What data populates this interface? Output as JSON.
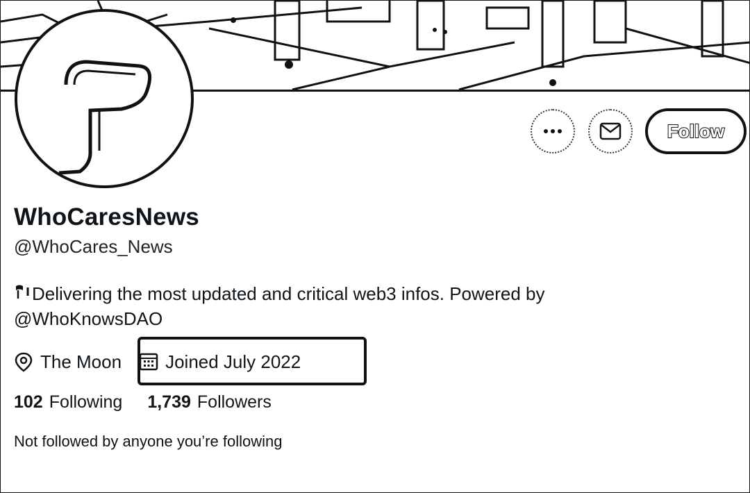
{
  "profile": {
    "display_name": "WhoCaresNews",
    "handle": "@WhoCares_News",
    "bio_line1": "Delivering the most updated and critical web3 infos. Powered by",
    "bio_line2": "@WhoKnowsDAO",
    "location": "The Moon",
    "joined": "Joined July 2022",
    "following_count": "102",
    "following_label": "Following",
    "followers_count": "1,739",
    "followers_label": "Followers",
    "social_context": "Not followed by anyone you’re following"
  },
  "actions": {
    "more_icon": "more-horizontal-icon",
    "message_icon": "envelope-icon",
    "follow_label": "Follow"
  },
  "icons": {
    "location": "location-pin-icon",
    "calendar": "calendar-icon",
    "bio_prefix": "flag-icon"
  },
  "colors": {
    "text": "#0f1419",
    "border": "#111111",
    "background": "#ffffff"
  }
}
